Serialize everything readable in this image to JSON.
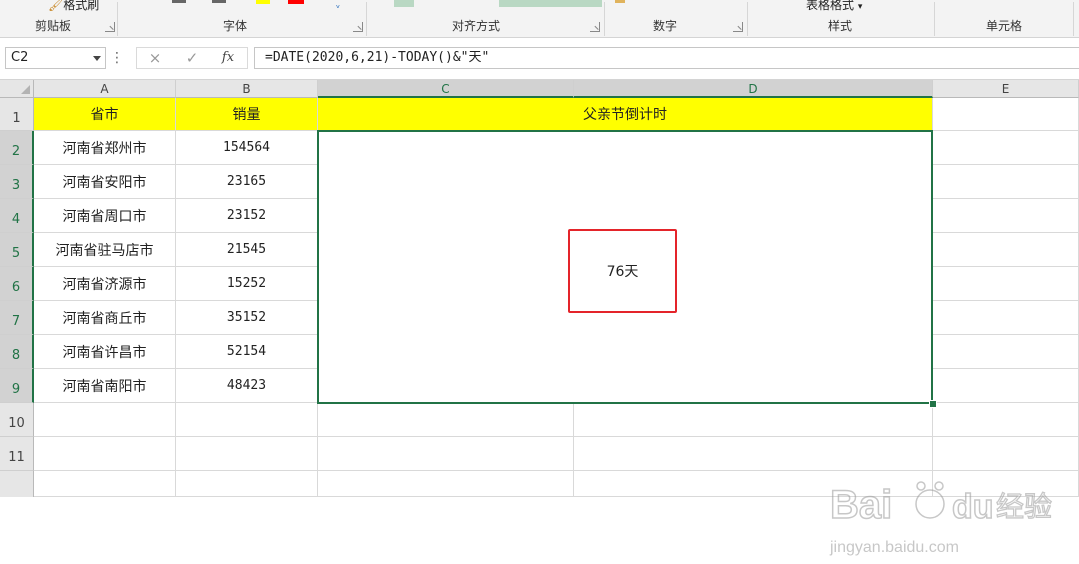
{
  "ribbon": {
    "clipboard": {
      "format_painter": "格式刷",
      "label": "剪贴板"
    },
    "font_label": "字体",
    "alignment_label": "对齐方式",
    "number_label": "数字",
    "styles": {
      "table_format": "表格格式",
      "label": "样式"
    },
    "cells_label": "单元格",
    "colors": {
      "highlight": "#ffff00",
      "font_color": "#ff0000",
      "accent": "#217346"
    }
  },
  "formula_bar": {
    "name_box": "C2",
    "cancel_icon": "×",
    "enter_icon": "✓",
    "fx_label": "fx",
    "formula": "=DATE(2020,6,21)-TODAY()&\"天\""
  },
  "sheet": {
    "columns": [
      "A",
      "B",
      "C",
      "D",
      "E"
    ],
    "rows": [
      "1",
      "2",
      "3",
      "4",
      "5",
      "6",
      "7",
      "8",
      "9",
      "10",
      "11"
    ],
    "header": {
      "a": "省市",
      "b": "销量",
      "cd": "父亲节倒计时"
    },
    "data": [
      {
        "city": "河南省郑州市",
        "sales": "154564"
      },
      {
        "city": "河南省安阳市",
        "sales": "23165"
      },
      {
        "city": "河南省周口市",
        "sales": "23152"
      },
      {
        "city": "河南省驻马店市",
        "sales": "21545"
      },
      {
        "city": "河南省济源市",
        "sales": "15252"
      },
      {
        "city": "河南省商丘市",
        "sales": "35152"
      },
      {
        "city": "河南省许昌市",
        "sales": "52154"
      },
      {
        "city": "河南省南阳市",
        "sales": "48423"
      }
    ],
    "countdown": "76天"
  },
  "watermark": {
    "brand": "Bai",
    "brand2": "du",
    "cn": "经验",
    "url": "jingyan.baidu.com"
  }
}
